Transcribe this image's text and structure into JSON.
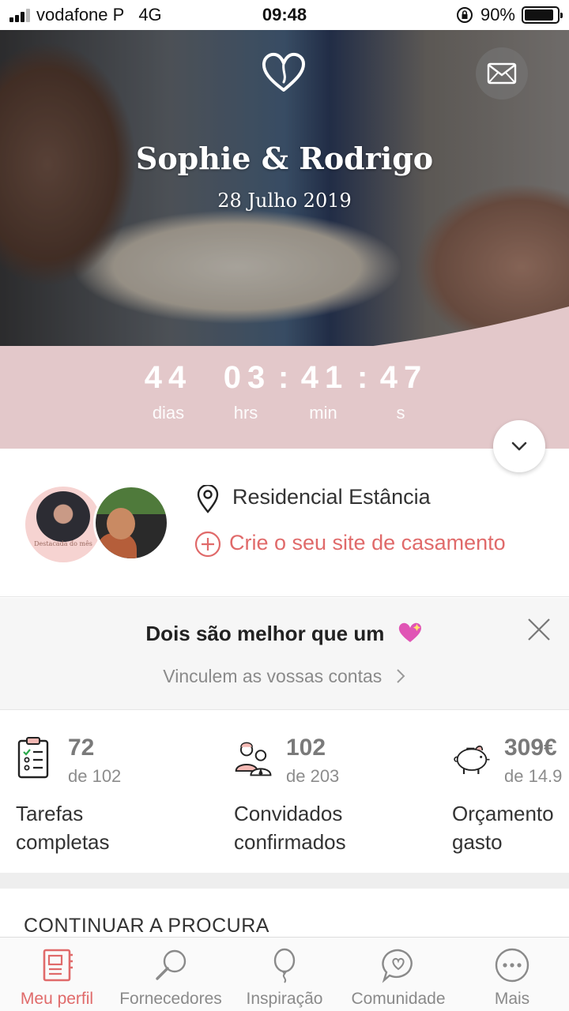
{
  "status_bar": {
    "carrier": "vodafone P",
    "network": "4G",
    "time": "09:48",
    "battery": "90%",
    "battery_level": 0.9
  },
  "hero": {
    "couple_names": "Sophie & Rodrigo",
    "wedding_date": "28 Julho 2019",
    "countdown": {
      "days": "44",
      "hours": "03",
      "minutes": "41",
      "seconds": "47",
      "days_label": "dias",
      "hours_label": "hrs",
      "minutes_label": "min",
      "seconds_label": "s"
    },
    "colors": {
      "band": "#e3c8ca",
      "accent": "#e06a6a"
    }
  },
  "profile": {
    "location": "Residencial Estância",
    "create_site": "Crie o seu site de casamento",
    "avatar_caption": "Destacada do mês"
  },
  "promo": {
    "title": "Dois são melhor que um",
    "subtitle": "Vinculem as vossas contas"
  },
  "stats": [
    {
      "value": "72",
      "of": "de 102",
      "label_line1": "Tarefas",
      "label_line2": "completas",
      "icon": "checklist-icon"
    },
    {
      "value": "102",
      "of": "de 203",
      "label_line1": "Convidados",
      "label_line2": "confirmados",
      "icon": "guests-icon"
    },
    {
      "value": "309€",
      "of": "de 14.9",
      "label_line1": "Orçamento",
      "label_line2": "gasto",
      "icon": "piggy-bank-icon"
    }
  ],
  "section": {
    "continue_title": "CONTINUAR A PROCURA"
  },
  "tabbar": {
    "tabs": [
      {
        "label": "Meu perfil",
        "icon": "notebook-icon",
        "active": true
      },
      {
        "label": "Fornecedores",
        "icon": "search-icon",
        "active": false
      },
      {
        "label": "Inspiração",
        "icon": "balloon-icon",
        "active": false
      },
      {
        "label": "Comunidade",
        "icon": "chat-heart-icon",
        "active": false
      },
      {
        "label": "Mais",
        "icon": "more-icon",
        "active": false
      }
    ]
  }
}
